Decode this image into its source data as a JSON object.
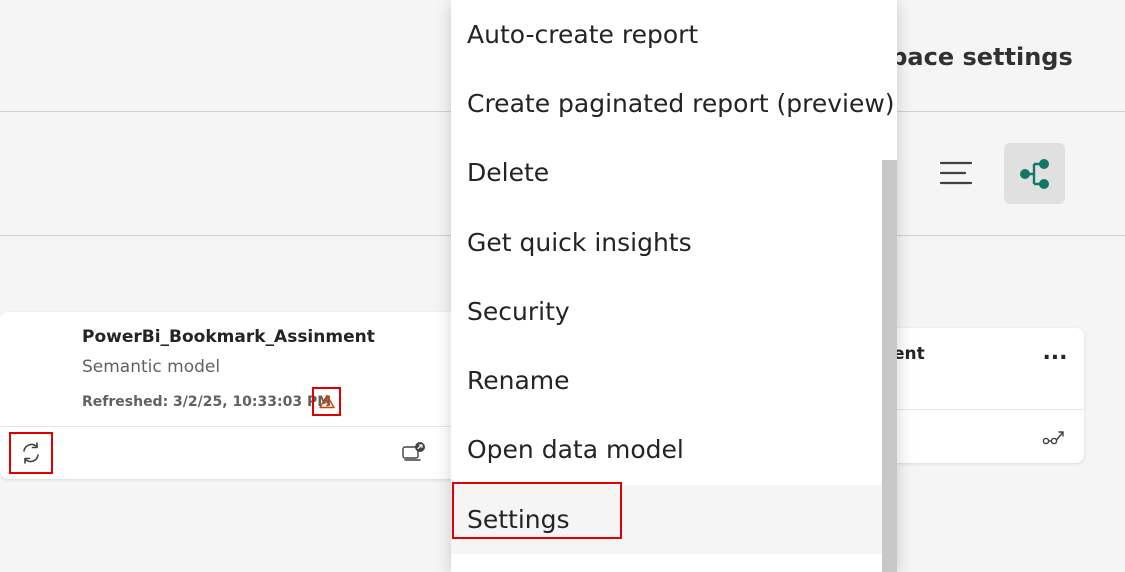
{
  "header": {
    "workspace_settings_label": "kspace settings"
  },
  "toolbar": {
    "list_view_icon": "list-view-icon",
    "lineage_view_icon": "lineage-view-icon",
    "accent_color": "#117865"
  },
  "semantic_card": {
    "title": "PowerBi_Bookmark_Assinment",
    "type": "Semantic model",
    "refreshed": "Refreshed: 3/2/25, 10:33:03 PM",
    "warning_icon": "warning-icon",
    "refresh_icon": "refresh-icon",
    "share_icon": "share-icon",
    "warning_color": "#d83b01",
    "highlight_color": "#e00000"
  },
  "right_card": {
    "title": "ent",
    "more_label": "...",
    "lineage_icon": "lineage-icon"
  },
  "context_menu": {
    "items": [
      {
        "label": "Auto-create report"
      },
      {
        "label": "Create paginated report (preview)"
      },
      {
        "label": "Delete"
      },
      {
        "label": "Get quick insights"
      },
      {
        "label": "Security"
      },
      {
        "label": "Rename"
      },
      {
        "label": "Open data model"
      },
      {
        "label": "Settings"
      }
    ]
  }
}
